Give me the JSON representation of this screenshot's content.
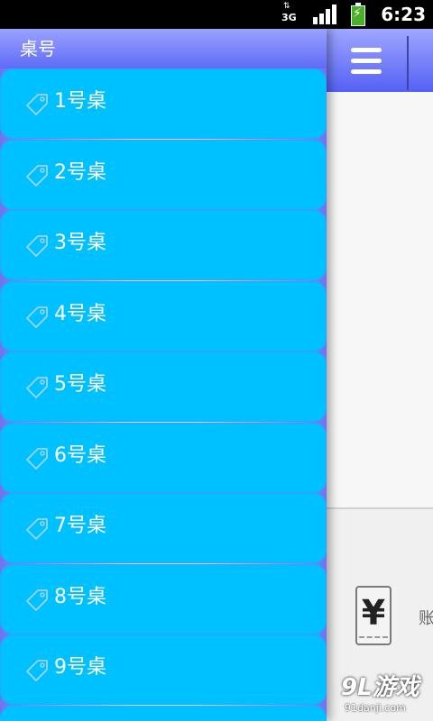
{
  "status_bar": {
    "network": "3G",
    "network_arrows": "⇅",
    "time": "6:23",
    "battery_bolt": "⚡"
  },
  "drawer": {
    "title": "桌号",
    "items": [
      {
        "label": "1号桌",
        "icon": "tag-icon"
      },
      {
        "label": "2号桌",
        "icon": "tag-icon"
      },
      {
        "label": "3号桌",
        "icon": "tag-icon"
      },
      {
        "label": "4号桌",
        "icon": "tag-icon"
      },
      {
        "label": "5号桌",
        "icon": "tag-icon"
      },
      {
        "label": "6号桌",
        "icon": "tag-icon"
      },
      {
        "label": "7号桌",
        "icon": "tag-icon"
      },
      {
        "label": "8号桌",
        "icon": "tag-icon"
      },
      {
        "label": "9号桌",
        "icon": "tag-icon"
      }
    ]
  },
  "main": {
    "menu_icon": "hamburger-menu-icon",
    "bill": {
      "icon": "yen-receipt-icon",
      "icon_glyph": "¥",
      "label": "账"
    }
  },
  "watermark": {
    "logo": "9L游戏",
    "site": "91danji.com"
  },
  "colors": {
    "item_bg": "#00c1ff",
    "header_gradient_top": "#9aa2ff",
    "header_gradient_bottom": "#5f6bf6"
  }
}
